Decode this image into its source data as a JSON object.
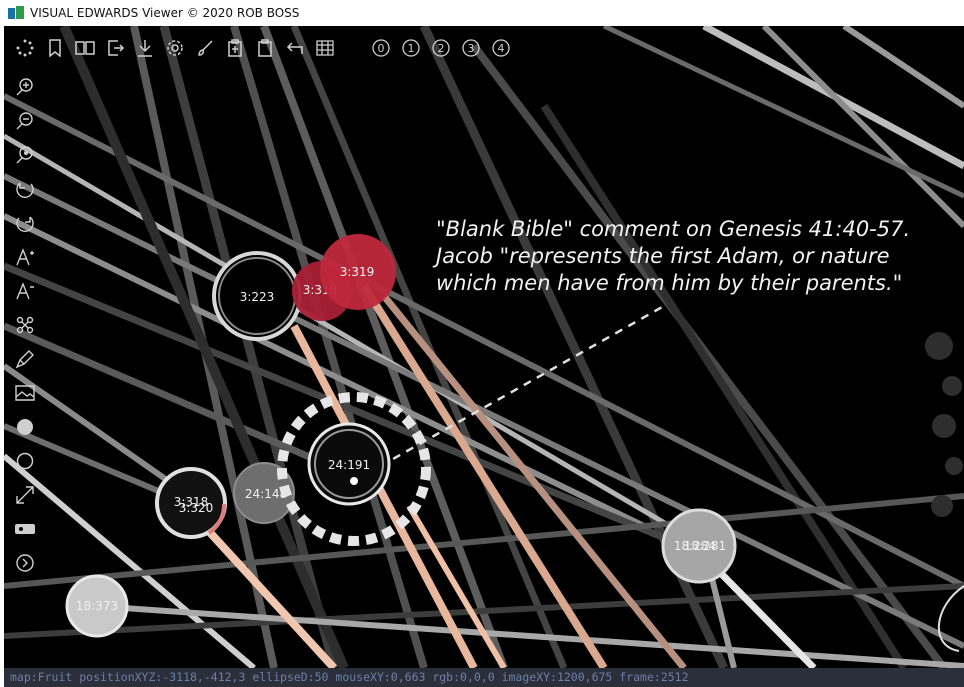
{
  "window": {
    "title": "VISUAL EDWARDS Viewer © 2020 ROB BOSS"
  },
  "toolbar": {
    "icons": [
      "loading-dots-icon",
      "bookmark-icon",
      "book-open-icon",
      "exit-icon",
      "download-icon",
      "settings-icon",
      "brush-icon",
      "clipboard-add-icon",
      "clipboard-icon",
      "undo-icon",
      "grid-icon"
    ],
    "numbered_buttons": [
      "0",
      "1",
      "2",
      "3",
      "4"
    ]
  },
  "sidebar": {
    "icons": [
      "zoom-in-icon",
      "zoom-out-icon",
      "zoom-reset-icon",
      "rotate-left-icon",
      "rotate-right-icon",
      "font-increase-icon",
      "font-decrease-icon",
      "network-icon",
      "highlighter-icon",
      "image-icon",
      "filled-circle-icon",
      "outline-circle-icon",
      "expand-icon",
      "record-icon",
      "next-icon"
    ]
  },
  "nodes": [
    {
      "label": "3:223",
      "style": "dark-ring"
    },
    {
      "label": "3:318",
      "style": "red"
    },
    {
      "label": "3:319",
      "style": "red"
    },
    {
      "label": "24:191",
      "style": "selected"
    },
    {
      "label": "3:318",
      "style": "dark-ring-overlap"
    },
    {
      "label": "3:320",
      "style": "dark-ring-overlap"
    },
    {
      "label": "24:148",
      "style": "grey"
    },
    {
      "label": "18:373",
      "style": "light-grey"
    },
    {
      "label": "18:284",
      "style": "light-grey-overlap"
    },
    {
      "label": "18:281",
      "style": "light-grey-overlap"
    }
  ],
  "annotation": {
    "lines": [
      "\"Blank Bible\" comment on Genesis 41:40-57.",
      "Jacob \"represents the first Adam, or nature",
      "which men have from him by their parents.\""
    ]
  },
  "status": {
    "text": "map:Fruit positionXYZ:-3118,-412,3 ellipseD:50 mouseXY:0,663 rgb:0,0,0 imageXY:1200,675 frame:2512"
  },
  "colors": {
    "background": "#000000",
    "red_node": "#c0283c",
    "status_bg": "#2a2f3a",
    "status_text": "#6e7ea6"
  }
}
